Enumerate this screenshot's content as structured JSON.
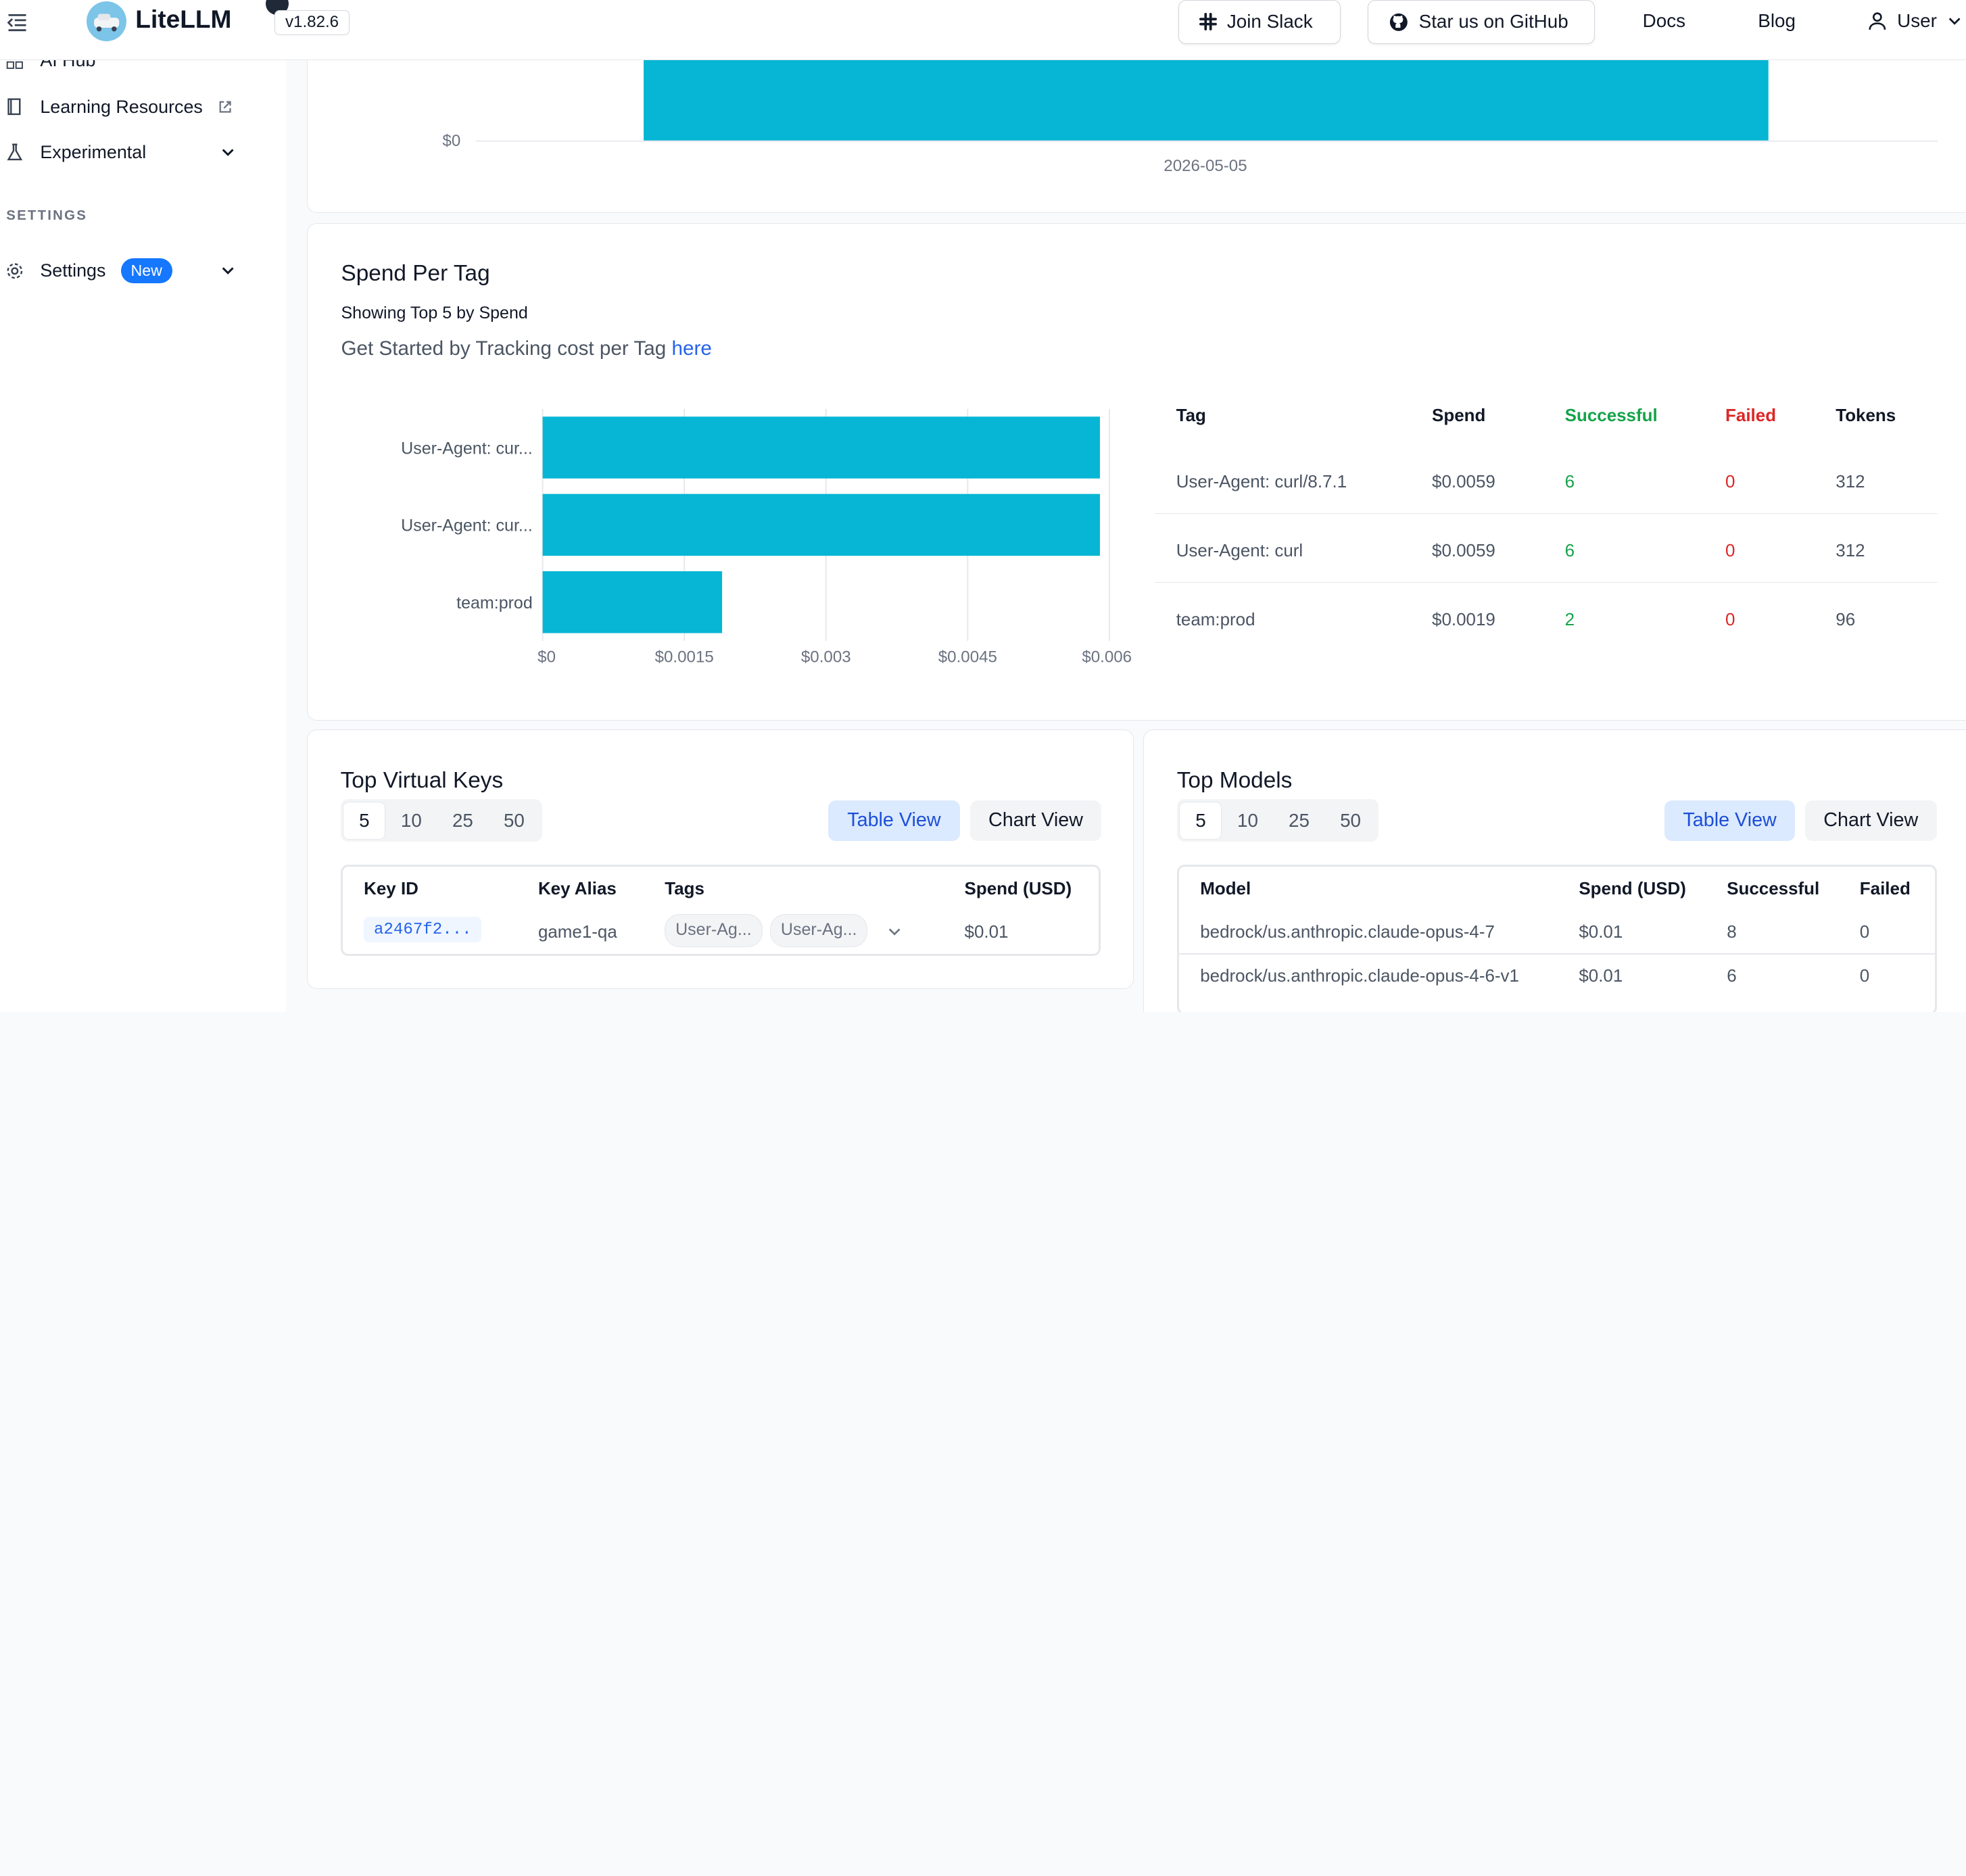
{
  "header": {
    "app_name": "LiteLLM",
    "version": "v1.82.6",
    "join_slack": "Join Slack",
    "star_github": "Star us on GitHub",
    "docs": "Docs",
    "blog": "Blog",
    "user": "User"
  },
  "sidebar": {
    "items": [
      {
        "label": "AI Hub",
        "icon": "grid-icon"
      },
      {
        "label": "Learning Resources",
        "icon": "book-icon"
      },
      {
        "label": "Experimental",
        "icon": "flask-icon"
      }
    ],
    "section_settings": "SETTINGS",
    "settings_label": "Settings",
    "settings_badge": "New"
  },
  "daily_spend": {
    "y_tick": "$0",
    "x_tick": "2026-05-05"
  },
  "spend_per_tag": {
    "title": "Spend Per Tag",
    "subtitle": "Showing Top 5 by Spend",
    "hint_prefix": "Get Started by Tracking cost per Tag ",
    "hint_link": "here",
    "table_headers": {
      "tag": "Tag",
      "spend": "Spend",
      "successful": "Successful",
      "failed": "Failed",
      "tokens": "Tokens"
    },
    "rows": [
      {
        "tag": "User-Agent: curl/8.7.1",
        "spend": "$0.0059",
        "successful": "6",
        "failed": "0",
        "tokens": "312"
      },
      {
        "tag": "User-Agent: curl",
        "spend": "$0.0059",
        "successful": "6",
        "failed": "0",
        "tokens": "312"
      },
      {
        "tag": "team:prod",
        "spend": "$0.0019",
        "successful": "2",
        "failed": "0",
        "tokens": "96"
      }
    ]
  },
  "chart_data": {
    "type": "bar",
    "orientation": "horizontal",
    "categories": [
      "User-Agent: cur...",
      "User-Agent: cur...",
      "team:prod"
    ],
    "values": [
      0.0059,
      0.0059,
      0.0019
    ],
    "x_ticks": [
      "$0",
      "$0.0015",
      "$0.003",
      "$0.0045",
      "$0.006"
    ],
    "xlim": [
      0,
      0.006
    ],
    "bar_color": "#06b6d4",
    "grid": true
  },
  "top_virtual_keys": {
    "title": "Top Virtual Keys",
    "limits": [
      "5",
      "10",
      "25",
      "50"
    ],
    "table_view": "Table View",
    "chart_view": "Chart View",
    "headers": {
      "key_id": "Key ID",
      "key_alias": "Key Alias",
      "tags": "Tags",
      "spend": "Spend (USD)"
    },
    "rows": [
      {
        "key_id": "a2467f2...",
        "key_alias": "game1-qa",
        "tag1": "User-Ag...",
        "tag2": "User-Ag...",
        "spend": "$0.01"
      }
    ]
  },
  "top_models": {
    "title": "Top Models",
    "limits": [
      "5",
      "10",
      "25",
      "50"
    ],
    "table_view": "Table View",
    "chart_view": "Chart View",
    "headers": {
      "model": "Model",
      "spend": "Spend (USD)",
      "successful": "Successful",
      "failed": "Failed"
    },
    "rows": [
      {
        "model": "bedrock/us.anthropic.claude-opus-4-7",
        "spend": "$0.01",
        "successful": "8",
        "failed": "0"
      },
      {
        "model": "bedrock/us.anthropic.claude-opus-4-6-v1",
        "spend": "$0.01",
        "successful": "6",
        "failed": "0"
      }
    ]
  }
}
